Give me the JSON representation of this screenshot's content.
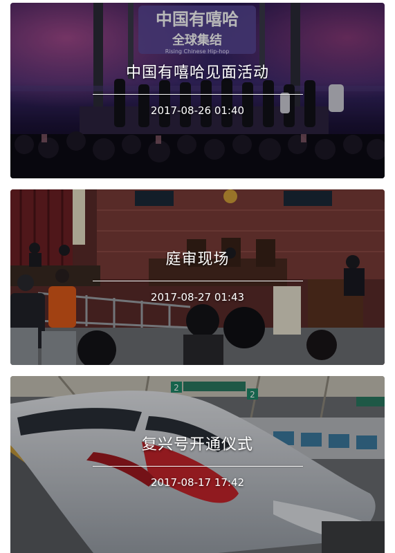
{
  "cards": [
    {
      "title": "中国有嘻哈见面活动",
      "date": "2017-08-26 01:40",
      "photo_text": {
        "main": "中国有嘻哈",
        "sub": "全球集结",
        "tagline": "Rising Chinese Hip-hop"
      }
    },
    {
      "title": "庭审现场",
      "date": "2017-08-27 01:43"
    },
    {
      "title": "复兴号开通仪式",
      "date": "2017-08-17 17:42",
      "photo_text": {
        "platform_numbers": [
          "2",
          "2"
        ]
      }
    }
  ],
  "colors": {
    "overlay_text": "#ffffff",
    "concert_purple": "#3b2466",
    "court_red": "#6b2a26",
    "train_red": "#c8242b"
  }
}
